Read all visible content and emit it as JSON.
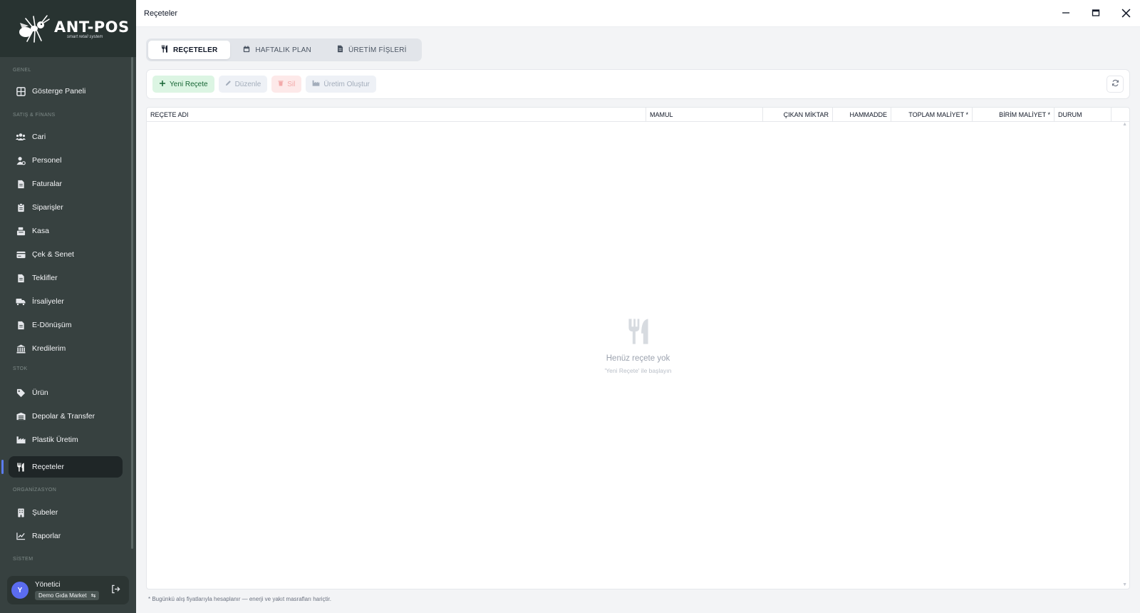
{
  "logo": {
    "title": "ANT-POS",
    "subtitle": "smart retail system"
  },
  "sidebar": {
    "sections": [
      {
        "label": "GENEL"
      },
      {
        "label": "SATIŞ & FİNANS"
      },
      {
        "label": "STOK"
      },
      {
        "label": "ORGANİZASYON"
      },
      {
        "label": "SİSTEM"
      }
    ],
    "items": [
      {
        "label": "Gösterge Paneli",
        "icon": "dashboard-icon"
      },
      {
        "label": "Cari",
        "icon": "users-icon"
      },
      {
        "label": "Personel",
        "icon": "user-gear-icon"
      },
      {
        "label": "Faturalar",
        "icon": "invoice-icon"
      },
      {
        "label": "Siparişler",
        "icon": "clipboard-icon"
      },
      {
        "label": "Kasa",
        "icon": "cash-register-icon"
      },
      {
        "label": "Çek & Senet",
        "icon": "card-icon"
      },
      {
        "label": "Teklifler",
        "icon": "document-icon"
      },
      {
        "label": "İrsaliyeler",
        "icon": "truck-icon"
      },
      {
        "label": "E-Dönüşüm",
        "icon": "e-document-icon"
      },
      {
        "label": "Kredilerim",
        "icon": "bank-icon"
      },
      {
        "label": "Ürün",
        "icon": "tag-icon"
      },
      {
        "label": "Depolar & Transfer",
        "icon": "warehouse-icon"
      },
      {
        "label": "Plastik Üretim",
        "icon": "factory-icon"
      },
      {
        "label": "Reçeteler",
        "icon": "utensils-icon",
        "active": true
      },
      {
        "label": "Şubeler",
        "icon": "building-icon"
      },
      {
        "label": "Raporlar",
        "icon": "chart-line-icon"
      }
    ],
    "user": {
      "initial": "Y",
      "name": "Yönetici",
      "store": "Demo Gıda Market"
    }
  },
  "window": {
    "title": "Reçeteler"
  },
  "tabs": [
    {
      "label": "REÇETELER",
      "active": true
    },
    {
      "label": "HAFTALIK PLAN",
      "active": false
    },
    {
      "label": "ÜRETİM FİŞLERİ",
      "active": false
    }
  ],
  "toolbar": {
    "new_label": "Yeni Reçete",
    "edit_label": "Düzenle",
    "delete_label": "Sil",
    "produce_label": "Üretim Oluştur"
  },
  "grid": {
    "columns": [
      "REÇETE ADI",
      "MAMUL",
      "ÇIKAN MİKTAR",
      "HAMMADDE",
      "TOPLAM MALİYET *",
      "BİRİM MALİYET *",
      "DURUM"
    ],
    "rows": []
  },
  "empty_state": {
    "title": "Henüz reçete yok",
    "subtitle": "'Yeni Reçete' ile başlayın"
  },
  "footnote": "* Bugünkü alış fiyatlarıyla hesaplanır — enerji ve yakıt masrafları hariçtir.",
  "colors": {
    "sidebar": "#374140",
    "accent": "#5b7cf0",
    "new_button_bg": "#dcf5e3",
    "new_button_text": "#166534"
  }
}
